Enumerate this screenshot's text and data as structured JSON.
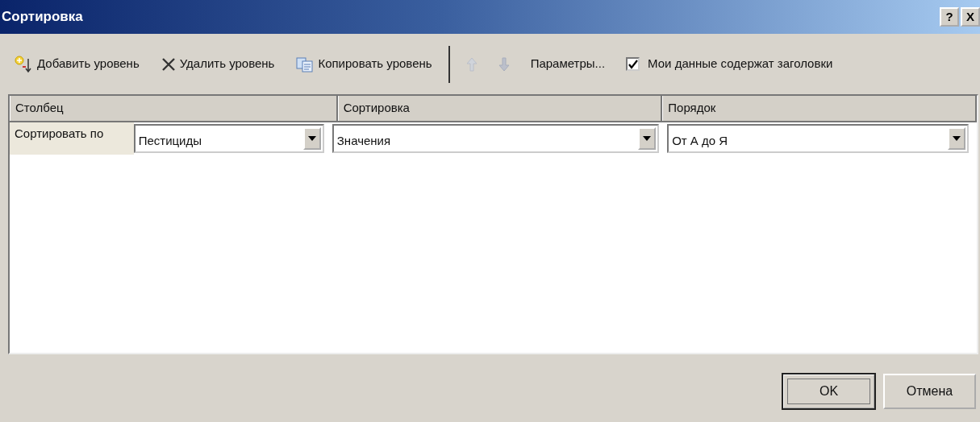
{
  "window": {
    "title": "Сортировка",
    "controls": [
      "?",
      "X"
    ]
  },
  "toolbar": [
    {
      "kind": "add",
      "label": "Добавить уровень",
      "disabled": false
    },
    {
      "kind": "delete",
      "label": "Удалить уровень",
      "disabled": false
    },
    {
      "kind": "copy",
      "label": "Копировать уровень",
      "disabled": false
    },
    {
      "kind": "separator"
    },
    {
      "kind": "up",
      "disabled": true
    },
    {
      "kind": "down",
      "disabled": true
    },
    {
      "kind": "options",
      "label": "Параметры...",
      "disabled": false
    },
    {
      "kind": "checkbox",
      "label": "Мои данные содержат заголовки",
      "checked": true
    }
  ],
  "grid": {
    "columns": [
      "Столбец",
      "Сортировка",
      "Порядок"
    ],
    "rows": [
      {
        "label": "Сортировать по",
        "column": "Пестициды",
        "sort_on": "Значения",
        "order": "От А до Я"
      }
    ]
  },
  "buttons": [
    {
      "label": "OK",
      "default": true
    },
    {
      "label": "Отмена",
      "default": false
    }
  ]
}
